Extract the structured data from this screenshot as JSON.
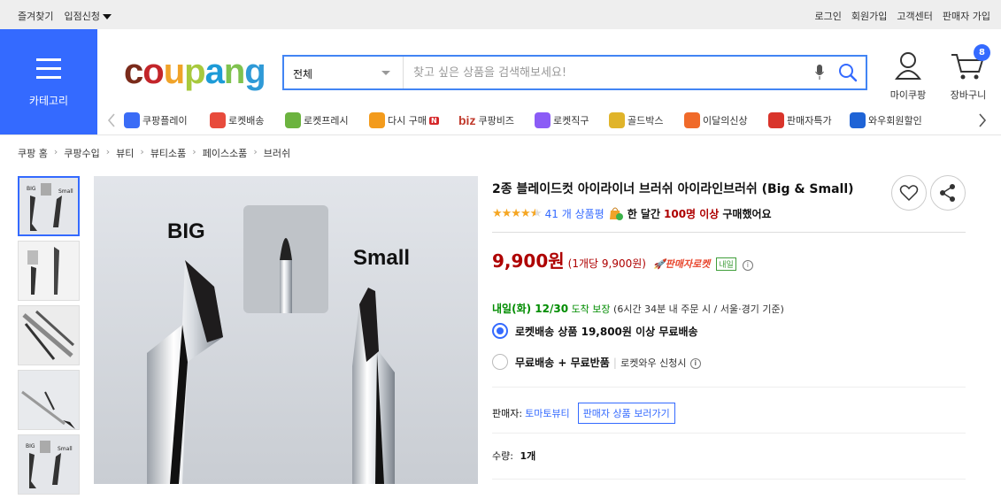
{
  "topbar": {
    "favorites": "즐겨찾기",
    "store_apply": "입점신청",
    "login": "로그인",
    "signup": "회원가입",
    "support": "고객센터",
    "seller_signup": "판매자 가입"
  },
  "category": {
    "label": "카테고리"
  },
  "logo": {
    "letters": [
      "c",
      "o",
      "u",
      "p",
      "a",
      "n",
      "g"
    ],
    "colors": [
      "#7a2b1b",
      "#c3252a",
      "#f0a329",
      "#a8c93d",
      "#1d9bd7",
      "#7fc24f",
      "#2f9ad7"
    ]
  },
  "search": {
    "category": "전체",
    "placeholder": "찾고 싶은 상품을 검색해보세요!"
  },
  "utility": {
    "mycoupang": "마이쿠팡",
    "cart": "장바구니",
    "cart_count": "8"
  },
  "nav": [
    {
      "label": "쿠팡플레이",
      "color": "#3a6cf6"
    },
    {
      "label": "로켓배송",
      "color": "#e84b3c"
    },
    {
      "label": "로켓프레시",
      "color": "#6cb33f"
    },
    {
      "label": "다시 구매",
      "color": "#f39b1c",
      "tag": "N"
    },
    {
      "label": "쿠팡비즈",
      "prefix": "biz"
    },
    {
      "label": "로켓직구",
      "color": "#8b5cf6"
    },
    {
      "label": "골드박스",
      "color": "#e0b42a"
    },
    {
      "label": "이달의신상",
      "color": "#f06a2a"
    },
    {
      "label": "판매자특가",
      "color": "#d9342b"
    },
    {
      "label": "와우회원할인",
      "color": "#1f64d6"
    }
  ],
  "breadcrumb": [
    "쿠팡 홈",
    "쿠팡수입",
    "뷰티",
    "뷰티소품",
    "페이스소품",
    "브러쉬"
  ],
  "product": {
    "title": "2종 블레이드컷 아이라이너 브러쉬 아이라인브러쉬 (Big & Small)",
    "rating": 4.5,
    "review_count": "41 개 상품평",
    "purchase_prefix": "한 달간",
    "purchase_count": "100명 이상",
    "purchase_suffix": "구매했어요",
    "price": "9,900원",
    "unit_price": "(1개당 9,900원)",
    "rocket_label": "판매자로켓",
    "rocket_tag": "내일",
    "image_labels": {
      "big": "BIG",
      "small": "Small"
    }
  },
  "delivery": {
    "date": "내일(화) 12/30",
    "guarantee": "도착 보장",
    "note": "(6시간 34분 내 주문 시 / 서울·경기 기준)"
  },
  "shipping_options": [
    {
      "label": "로켓배송 상품 19,800원 이상 무료배송",
      "selected": true
    },
    {
      "label": "무료배송 + 무료반품",
      "extra": "로켓와우 신청시",
      "selected": false
    }
  ],
  "seller": {
    "prefix": "판매자:",
    "name": "토마토뷰티",
    "button": "판매자 상품 보러가기"
  },
  "quantity": {
    "label": "수량:",
    "value": "1개"
  }
}
